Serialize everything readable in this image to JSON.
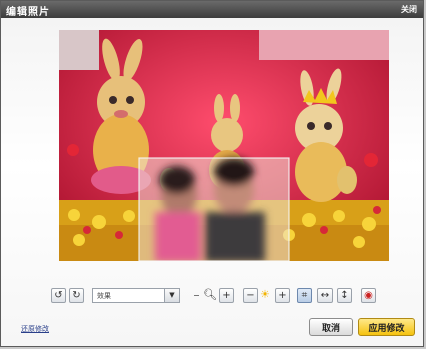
{
  "dialog": {
    "title": "编辑照片",
    "close_label": "关闭"
  },
  "photo": {
    "description_icon": "photo-canvas"
  },
  "toolbar": {
    "rotate_left_icon": "rotate-left-icon",
    "rotate_right_icon": "rotate-right-icon",
    "effect_select": {
      "value": "效果"
    },
    "zoom_out_label": "−",
    "zoom_in_label": "+",
    "brightness_down_label": "−",
    "brightness_up_label": "+"
  },
  "footer": {
    "revert_label": "还原修改",
    "cancel_label": "取消",
    "apply_label": "应用修改"
  },
  "colors": {
    "title_bar": "#4a4a4a",
    "apply_button": "#f5c20f",
    "photo_bg": "#c21b3a"
  }
}
